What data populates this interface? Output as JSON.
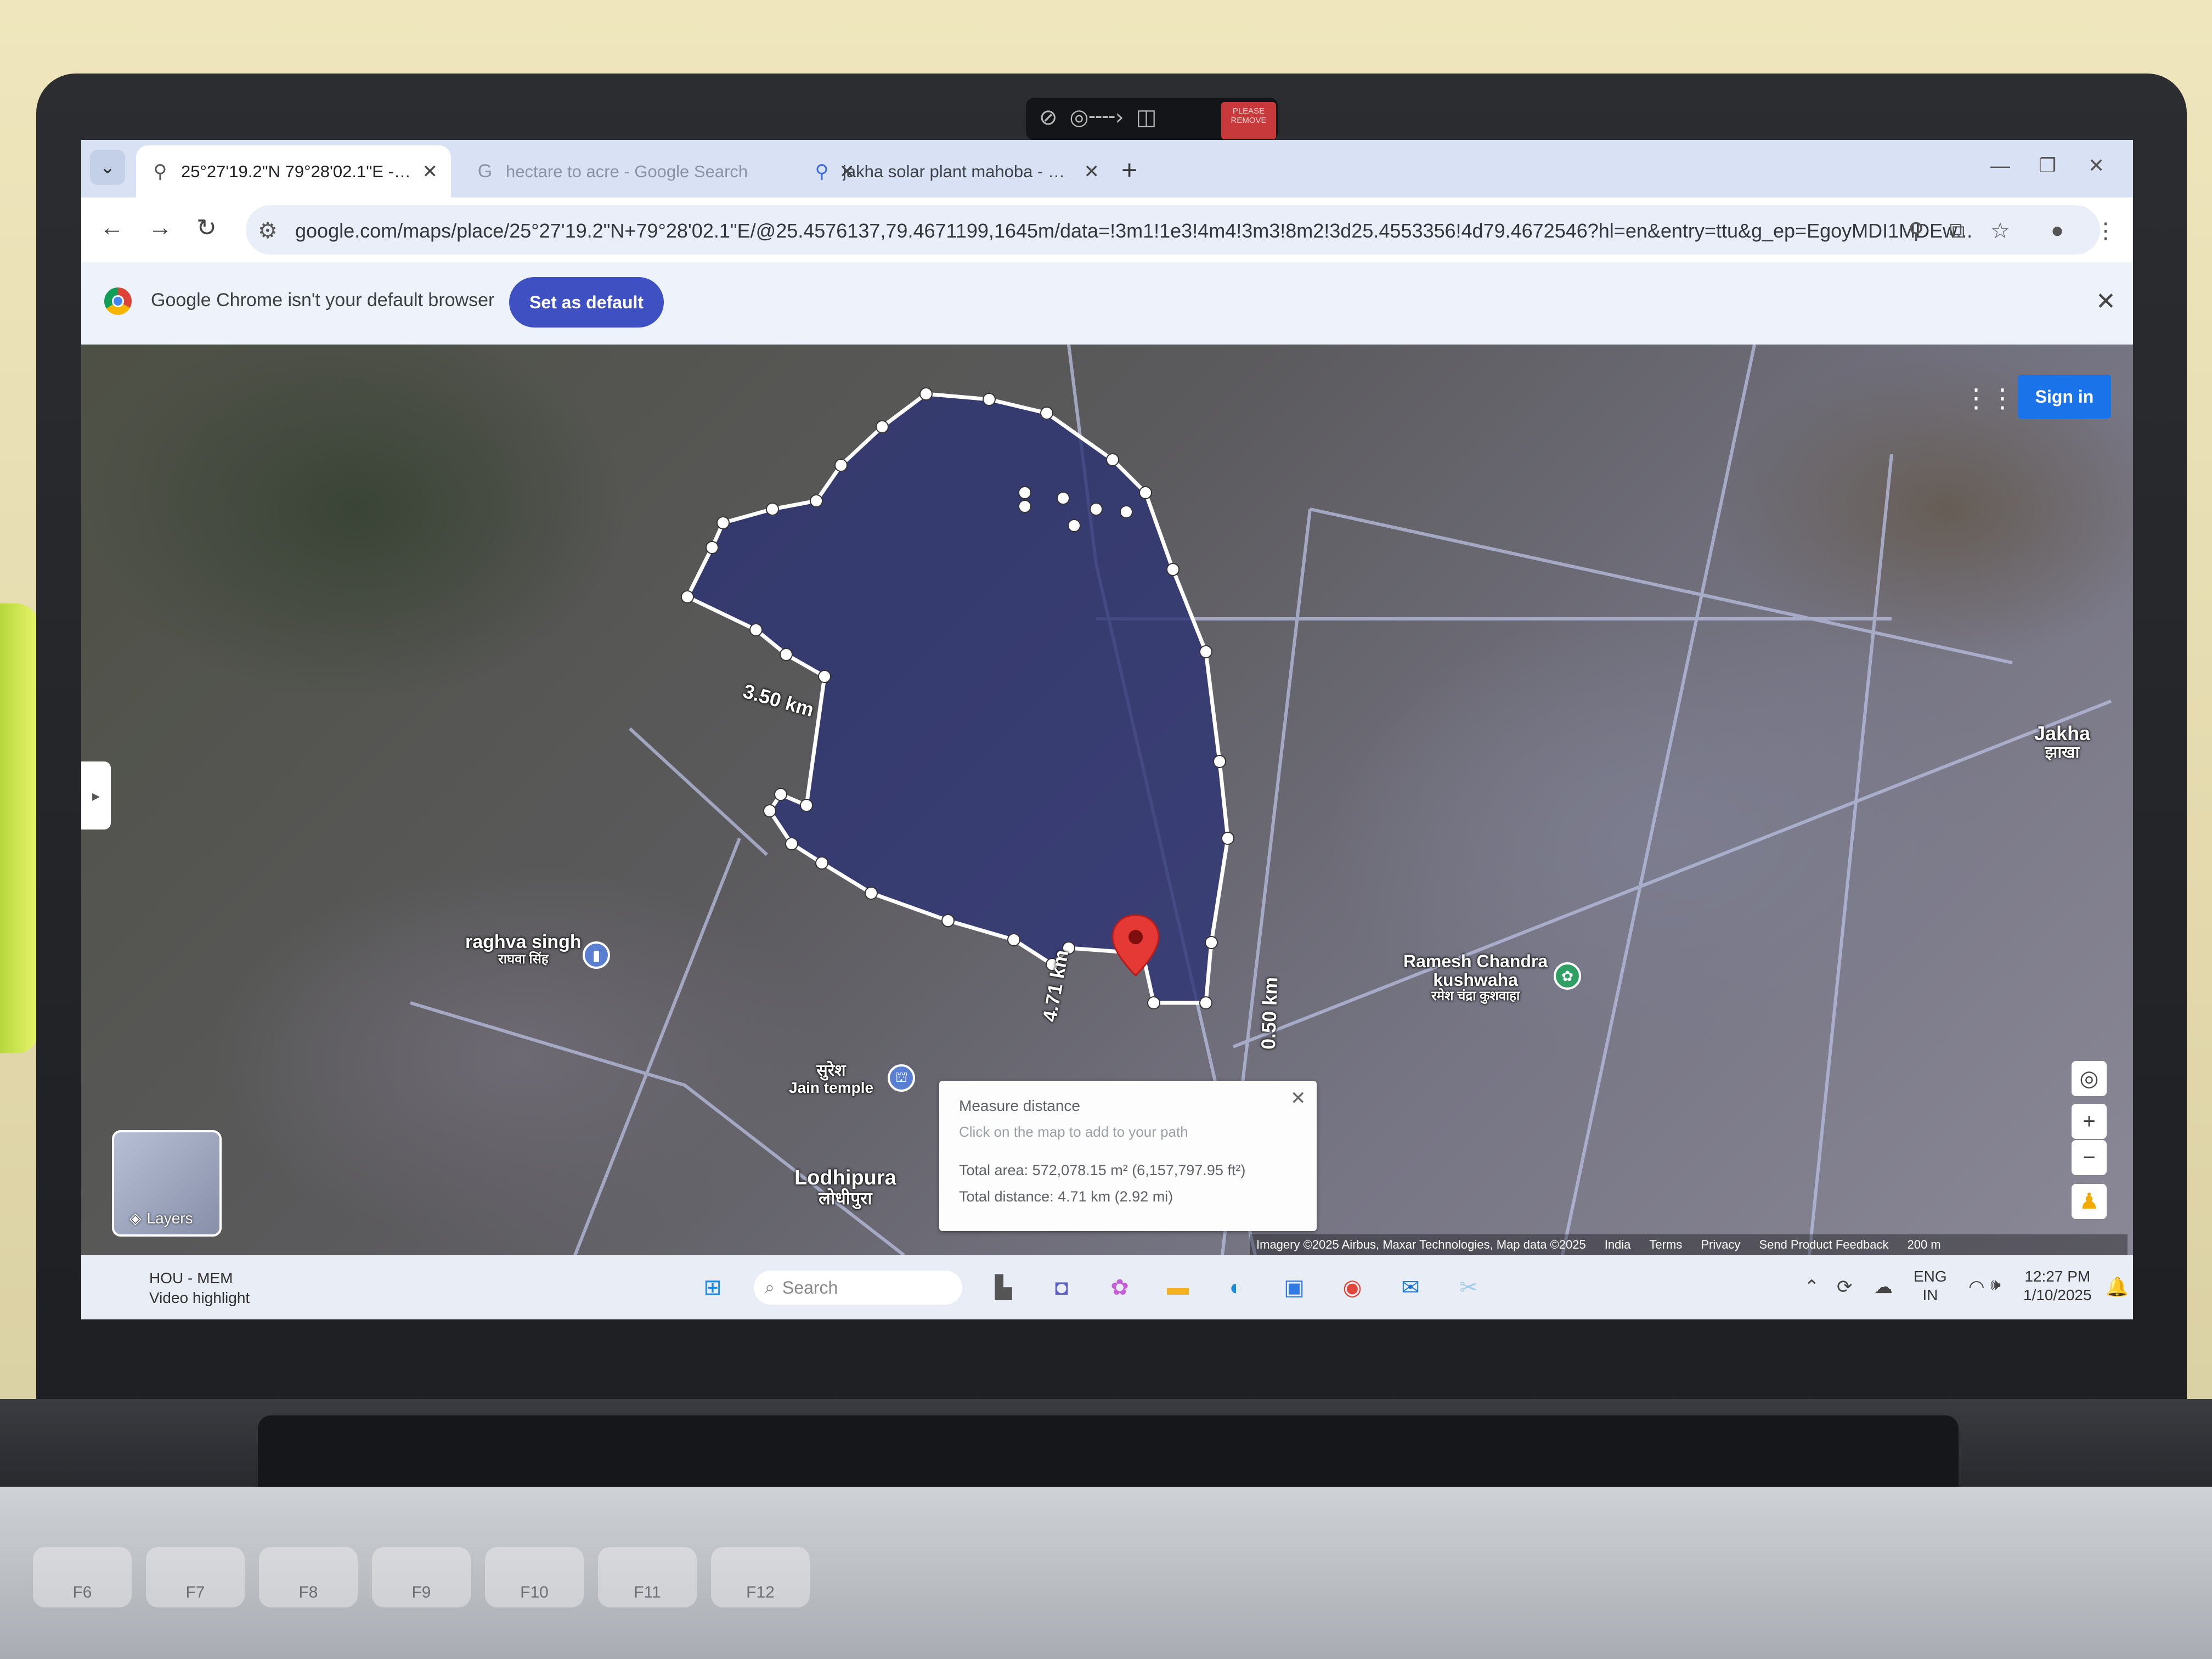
{
  "camera_cover": {
    "note": "PLEASE REMOVE"
  },
  "browser": {
    "tabs": [
      {
        "label": "25°27'19.2\"N 79°28'02.1\"E - Goo",
        "icon": "maps-pin-icon",
        "active": true
      },
      {
        "label": "hectare to acre - Google Search",
        "icon": "google-icon",
        "active": false
      },
      {
        "label": "jakha solar plant mahoba - Goo",
        "icon": "maps-pin-icon",
        "active": false
      }
    ],
    "url": "google.com/maps/place/25°27'19.2\"N+79°28'02.1\"E/@25.4576137,79.4671199,1645m/data=!3m1!1e3!4m4!3m3!8m2!3d25.4553356!4d79.4672546?hl=en&entry=ttu&g_ep=EgoyMDI1MDEw..."
  },
  "infobar": {
    "message": "Google Chrome isn't your default browser",
    "button": "Set as default"
  },
  "map": {
    "signin": "Sign in",
    "labels": {
      "jakha_en": "Jakha",
      "jakha_hi": "झाखा",
      "raghva_en": "raghva singh",
      "raghva_hi": "राघवा सिंह",
      "ramesh_en1": "Ramesh Chandra",
      "ramesh_en2": "kushwaha",
      "ramesh_hi": "रमेश चंद्रा कुशवाहा",
      "suresh_hi": "सुरेश",
      "suresh_en": "Jain temple",
      "lodhipura_en": "Lodhipura",
      "lodhipura_hi": "लोधीपुरा"
    },
    "segment_labels": [
      "3.50 km",
      "4.71 km",
      "0.50 km"
    ],
    "layers_label": "Layers",
    "measure": {
      "title": "Measure distance",
      "hint": "Click on the map to add to your path",
      "area": "Total area: 572,078.15 m² (6,157,797.95 ft²)",
      "distance": "Total distance: 4.71 km (2.92 mi)"
    },
    "attribution": [
      "Imagery ©2025 Airbus, Maxar Technologies, Map data ©2025",
      "India",
      "Terms",
      "Privacy",
      "Send Product Feedback",
      "200 m"
    ]
  },
  "taskbar": {
    "weather_line1": "HOU - MEM",
    "weather_line2": "Video highlight",
    "search_placeholder": "Search",
    "lang1": "ENG",
    "lang2": "IN",
    "time": "12:27 PM",
    "date": "1/10/2025"
  },
  "keyboard": [
    "F6",
    "F7",
    "F8",
    "F9",
    "F10",
    "F11",
    "F12"
  ]
}
